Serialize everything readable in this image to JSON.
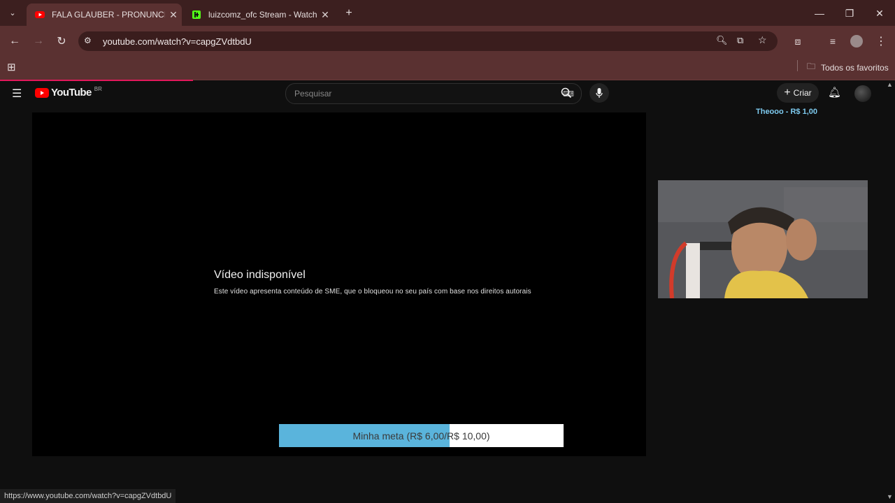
{
  "browser": {
    "tabs": [
      {
        "title": "FALA GLAUBER - PRONUNCIAN",
        "favicon": "youtube-favicon",
        "active": true
      },
      {
        "title": "luizcomz_ofc Stream - Watch Li",
        "favicon": "kick-favicon",
        "active": false
      }
    ],
    "url": "youtube.com/watch?v=capgZVdtbdU",
    "bookmarks_label": "Todos os favoritos",
    "status_url": "https://www.youtube.com/watch?v=capgZVdtbdU"
  },
  "youtube": {
    "logo_text": "YouTube",
    "region": "BR",
    "search_placeholder": "Pesquisar",
    "create_label": "Criar"
  },
  "player": {
    "error_title": "Vídeo indisponível",
    "error_message": "Este vídeo apresenta conteúdo de SME, que o bloqueou no seu país com base nos direitos autorais"
  },
  "overlay": {
    "donation": "Theooo - R$ 1,00",
    "goal_text": "Minha meta (R$ 6,00/R$ 10,00)",
    "goal_fraction": 0.6
  },
  "colors": {
    "tabbar": "#3c1f1f",
    "toolbar": "#5a3131",
    "youtube_red": "#ff0000",
    "goal_fill": "#5ab4dc",
    "donation_text": "#7ecbf0"
  }
}
